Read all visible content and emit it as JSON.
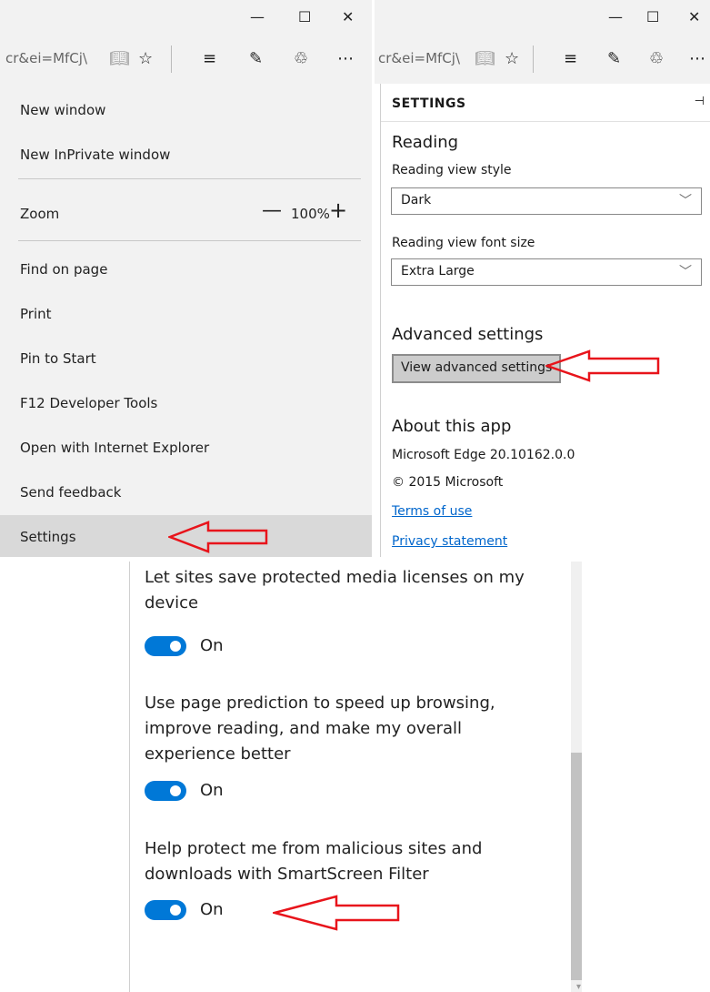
{
  "panel_left": {
    "url_text": "cr&ei=MfCj\\",
    "menu_items": {
      "new_window": "New window",
      "new_inprivate": "New InPrivate window",
      "zoom": "Zoom",
      "zoom_value": "100%",
      "find": "Find on page",
      "print": "Print",
      "pin": "Pin to Start",
      "f12": "F12 Developer Tools",
      "open_ie": "Open with Internet Explorer",
      "feedback": "Send feedback",
      "settings": "Settings"
    }
  },
  "panel_settings": {
    "url_text": "cr&ei=MfCj\\",
    "header": "SETTINGS",
    "reading_heading": "Reading",
    "reading_view_style_label": "Reading view style",
    "reading_view_style_value": "Dark",
    "reading_font_size_label": "Reading view font size",
    "reading_font_size_value": "Extra Large",
    "advanced_heading": "Advanced settings",
    "advanced_button": "View advanced settings",
    "about_heading": "About this app",
    "version": "Microsoft Edge 20.10162.0.0",
    "copyright": "© 2015 Microsoft",
    "terms_link": "Terms of use",
    "privacy_link": "Privacy statement"
  },
  "panel_advanced": {
    "items": [
      {
        "text": "Let sites save protected media licenses on my device",
        "state": "On"
      },
      {
        "text": "Use page prediction to speed up browsing, improve reading, and make my overall experience better",
        "state": "On"
      },
      {
        "text": "Help protect me from malicious sites and downloads with SmartScreen Filter",
        "state": "On"
      }
    ]
  },
  "colors": {
    "toggle_on": "#0078d7",
    "annotation_arrow": "#e8141b",
    "link": "#0066cc"
  }
}
